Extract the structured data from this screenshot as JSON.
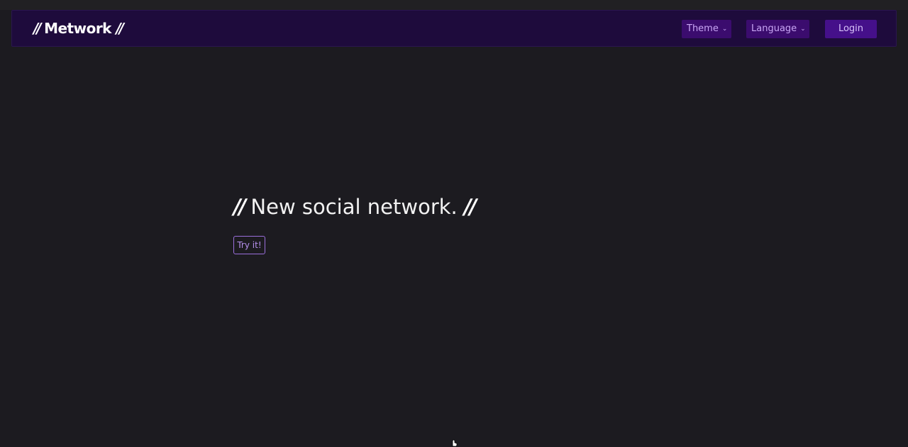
{
  "navbar": {
    "brand_slash_left": "//",
    "brand_name": "Metwork",
    "brand_slash_right": "//",
    "theme_label": "Theme",
    "language_label": "Language",
    "login_label": "Login"
  },
  "hero": {
    "slash_left": "//",
    "title": "New social network.",
    "slash_right": "//",
    "cta_label": "Try it!"
  },
  "icons": {
    "theme_dropdown": "chevron-down-icon",
    "language_dropdown": "chevron-down-icon",
    "cursor": "hand-cursor-icon"
  },
  "colors": {
    "page_background": "#1c1b20",
    "navbar_background": "#1e0b3c",
    "nav_button_background": "#3b0c6e",
    "nav_button_text": "#c9a6f5",
    "cta_border": "#9b6fdc",
    "cta_text": "#b690ee",
    "title_text": "#f2f2f2"
  }
}
